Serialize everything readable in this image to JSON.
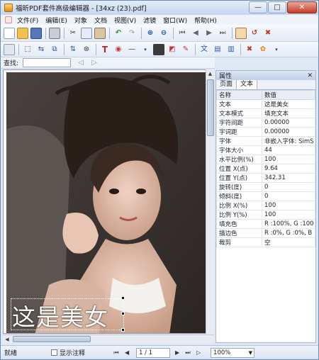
{
  "window": {
    "title": "福昕PDF套件高级编辑器 - [34xz (23).pdf]"
  },
  "window_buttons": {
    "minimize": "—",
    "maximize": "□",
    "close": "✕"
  },
  "menu": [
    "文件(F)",
    "编辑(E)",
    "对象",
    "文档",
    "视图(V)",
    "滤镜",
    "窗口(W)",
    "帮助(H)"
  ],
  "toolbar1_icons": [
    "new-icon",
    "open-icon",
    "save-icon",
    "print-icon",
    "cut-icon",
    "copy-icon",
    "paste-icon",
    "undo-icon",
    "redo-icon",
    "zoom-in-icon",
    "zoom-out-icon",
    "first-page-icon",
    "prev-page-icon",
    "next-page-icon",
    "last-page-icon",
    "properties-icon",
    "undo2-icon",
    "delete-icon"
  ],
  "toolbar2_icons": [
    "grid-icon",
    "select-icon",
    "rotate-icon",
    "crop-icon",
    "target-icon",
    "text-tool-icon",
    "color-icon",
    "line-tool-icon",
    "image-insert-icon",
    "rect-icon",
    "fill-icon",
    "text-edit-icon",
    "align-icon",
    "distribute-icon",
    "delete-object-icon",
    "palette-icon"
  ],
  "find": {
    "label": "查找:",
    "placeholder": ""
  },
  "canvas": {
    "overlay_text": "这是美女"
  },
  "panel": {
    "title": "属性",
    "tabs": [
      "页面",
      "文本"
    ],
    "columns": [
      "名称",
      "数值"
    ],
    "rows": [
      [
        "文本",
        "这是美女"
      ],
      [
        "文本模式",
        "填充文本"
      ],
      [
        "字符间距",
        "0.00000"
      ],
      [
        "字词距",
        "0.00000"
      ],
      [
        "字体",
        "非嵌入字体: SimS"
      ],
      [
        "字体大小",
        "44"
      ],
      [
        "水平比例(%)",
        "100"
      ],
      [
        "位置 X(点)",
        "9.64"
      ],
      [
        "位置 Y(点)",
        "342.31"
      ],
      [
        "旋转(度)",
        "0"
      ],
      [
        "倾斜(度)",
        "0"
      ],
      [
        "比例 X(%)",
        "100"
      ],
      [
        "比例 Y(%)",
        "100"
      ],
      [
        "填充色",
        "R :100%, G :100"
      ],
      [
        "描边色",
        "R :0%, G :0%, B"
      ],
      [
        "裁剪",
        "空"
      ]
    ]
  },
  "status": {
    "ready": "就绪",
    "show_annotations": "显示注释",
    "page": "1 / 1",
    "zoom": "100%"
  }
}
